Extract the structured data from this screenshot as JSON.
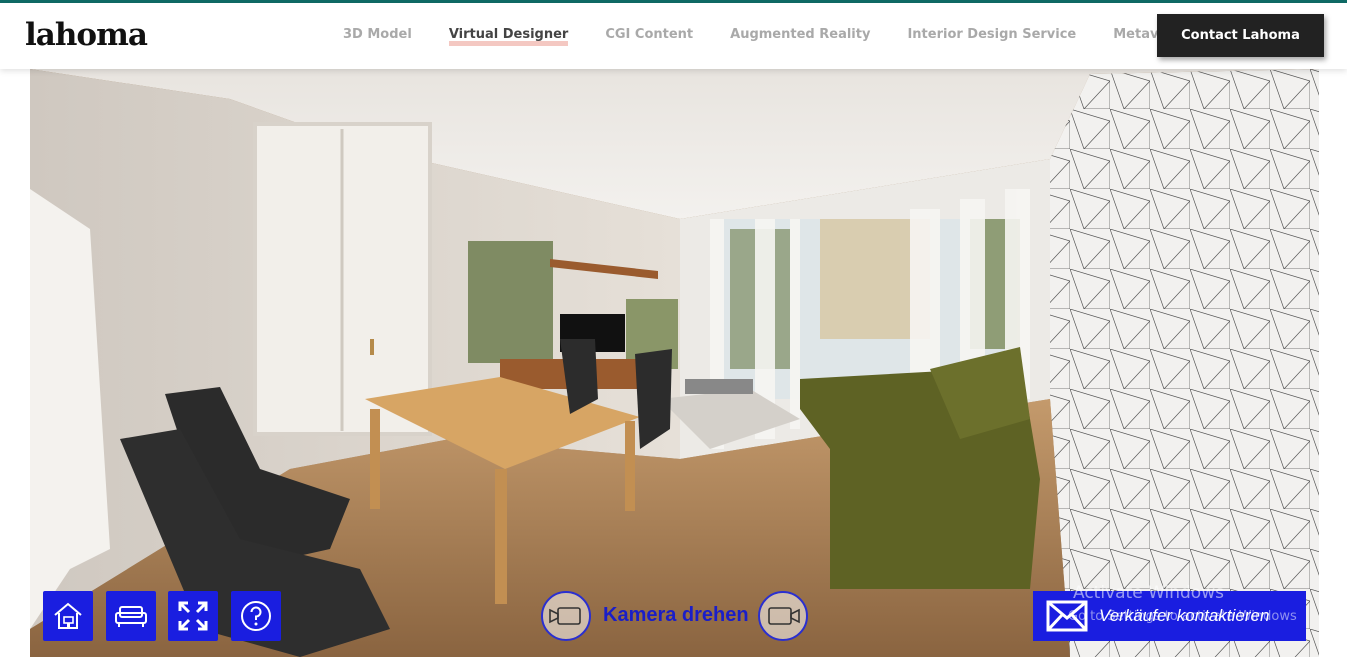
{
  "brand": {
    "logo": "lahoma"
  },
  "nav": {
    "items": [
      {
        "label": "3D Model",
        "active": false
      },
      {
        "label": "Virtual Designer",
        "active": true
      },
      {
        "label": "CGI Content",
        "active": false
      },
      {
        "label": "Augmented Reality",
        "active": false
      },
      {
        "label": "Interior Design Service",
        "active": false
      },
      {
        "label": "Metaverse",
        "active": false
      }
    ],
    "contact_label": "Contact Lahoma"
  },
  "viewer": {
    "tools": [
      {
        "icon": "house-paint-icon"
      },
      {
        "icon": "sofa-icon"
      },
      {
        "icon": "fullscreen-icon"
      },
      {
        "icon": "help-icon"
      }
    ],
    "camera": {
      "label": "Kamera drehen",
      "left_icon": "camera-rotate-left-icon",
      "right_icon": "camera-rotate-right-icon"
    },
    "seller": {
      "label": "Verkäufer kontaktieren",
      "icon": "mail-icon"
    },
    "watermark": {
      "line1": "Activate Windows",
      "line2": "Go to Settings to activate Windows"
    }
  },
  "colors": {
    "accent": "#1a1ee0",
    "topline": "#0f6b66",
    "nav_active_underline": "#f4c8c2",
    "contact_bg": "#222222"
  }
}
